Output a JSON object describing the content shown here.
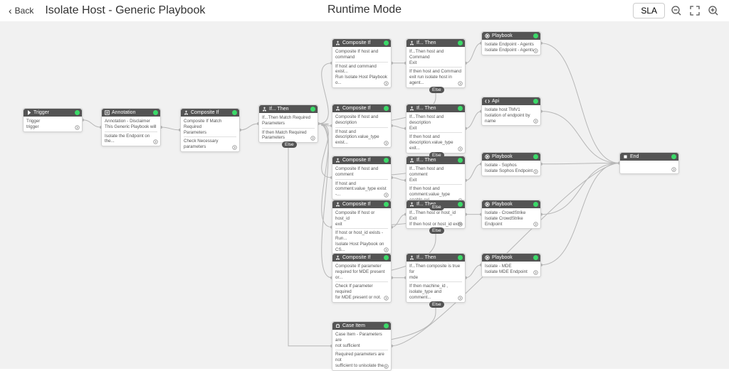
{
  "header": {
    "back_label": "Back",
    "title": "Isolate Host - Generic Playbook",
    "mode_title": "Runtime Mode",
    "sla_label": "SLA"
  },
  "else_label": "Else",
  "nodes": {
    "trigger": {
      "type": "Trigger",
      "line1": "Trigger",
      "line2": "trigger"
    },
    "annot": {
      "type": "Annotation",
      "line1": "Annotation - Disclaimer",
      "line2": "This Generic Playbook will",
      "line3": "Isolate the Endpoint on the..."
    },
    "cif_main": {
      "type": "Composite If",
      "line1": "Composite If Match Required",
      "line2": "Parameters",
      "line3": "Check Necessary parameters"
    },
    "if_main": {
      "type": "If... Then",
      "line1": "If...Then Match Required",
      "line2": "Parameters",
      "line3": "If then Match Required",
      "line4": "Parameters"
    },
    "cif_1": {
      "type": "Composite If",
      "line1": "Composite If host and",
      "line2": "command",
      "line3": "If host and command exist...",
      "line4": "Run Isolate Host Playbook o..."
    },
    "if_1": {
      "type": "If... Then",
      "line1": "If...Then host and Command",
      "line2": "Exit",
      "line3": "If then host and Command",
      "line4": "exit run isolate host in agent..."
    },
    "pb_1": {
      "type": "Playbook",
      "line1": "Isolate Endpoint - Agents",
      "line2": "Isolate Endpoint - Agents"
    },
    "cif_2": {
      "type": "Composite If",
      "line1": "Composite If host and",
      "line2": "description",
      "line3": "If host and",
      "line4": "description.value_type exist..."
    },
    "if_2": {
      "type": "If... Then",
      "line1": "If...Then host and description",
      "line2": "Exit",
      "line3": "If then host and",
      "line4": "description.value_type exit..."
    },
    "api": {
      "type": "Api",
      "line1": "Isolate host TMV1",
      "line2": "Isolation of endpoint by name"
    },
    "cif_3": {
      "type": "Composite If",
      "line1": "Composite If host and",
      "line2": "comment",
      "line3": "If host and",
      "line4": "comment.value_type exist -..."
    },
    "if_3": {
      "type": "If... Then",
      "line1": "If...Then host and comment",
      "line2": "Exit",
      "line3": "If then host and",
      "line4": "comment.value_type enable exi..."
    },
    "pb_3": {
      "type": "Playbook",
      "line1": "Isolate - Sophos",
      "line2": "Isolate Sophos Endpoint"
    },
    "cif_4": {
      "type": "Composite If",
      "line1": "Composite If host or host_id",
      "line2": "exit",
      "line3": "If host or host_id exists - Run...",
      "line4": "Isolate Host Playbook on CS..."
    },
    "if_4": {
      "type": "If... Then",
      "line1": "If...Then host or host_id Exit",
      "line2": "If then host or host_id exist"
    },
    "pb_4": {
      "type": "Playbook",
      "line1": "Isolate - CrowdStrike",
      "line2": "Isolate CrowdStrike Endpoint"
    },
    "cif_5": {
      "type": "Composite If",
      "line1": "Composite If parameter",
      "line2": "required for MDE present or...",
      "line3": "Check If parameter required",
      "line4": "for MDE present or not."
    },
    "if_5": {
      "type": "If... Then",
      "line1": "If...Then composite is true for",
      "line2": "mde",
      "line3": "If then machine_id ,",
      "line4": "isolate_type and comment..."
    },
    "pb_5": {
      "type": "Playbook",
      "line1": "Isolate - MDE",
      "line2": "Isolate MDE Endpoint"
    },
    "caseitem": {
      "type": "Case Item",
      "line1": "Case Item - Parameters are",
      "line2": "not sufficient",
      "line3": "Required parameters are not",
      "line4": "sufficient to unisolate the..."
    },
    "end": {
      "type": "End"
    }
  },
  "chart_data": {
    "type": "flow_diagram",
    "nodes": [
      {
        "id": "trigger",
        "kind": "Trigger"
      },
      {
        "id": "annot",
        "kind": "Annotation"
      },
      {
        "id": "cif_main",
        "kind": "Composite If"
      },
      {
        "id": "if_main",
        "kind": "If... Then"
      },
      {
        "id": "cif_1",
        "kind": "Composite If"
      },
      {
        "id": "if_1",
        "kind": "If... Then"
      },
      {
        "id": "pb_1",
        "kind": "Playbook"
      },
      {
        "id": "cif_2",
        "kind": "Composite If"
      },
      {
        "id": "if_2",
        "kind": "If... Then"
      },
      {
        "id": "api",
        "kind": "Api"
      },
      {
        "id": "cif_3",
        "kind": "Composite If"
      },
      {
        "id": "if_3",
        "kind": "If... Then"
      },
      {
        "id": "pb_3",
        "kind": "Playbook"
      },
      {
        "id": "cif_4",
        "kind": "Composite If"
      },
      {
        "id": "if_4",
        "kind": "If... Then"
      },
      {
        "id": "pb_4",
        "kind": "Playbook"
      },
      {
        "id": "cif_5",
        "kind": "Composite If"
      },
      {
        "id": "if_5",
        "kind": "If... Then"
      },
      {
        "id": "pb_5",
        "kind": "Playbook"
      },
      {
        "id": "caseitem",
        "kind": "Case Item"
      },
      {
        "id": "end",
        "kind": "End"
      }
    ],
    "edges": [
      [
        "trigger",
        "annot"
      ],
      [
        "annot",
        "cif_main"
      ],
      [
        "cif_main",
        "if_main"
      ],
      [
        "if_main",
        "cif_1"
      ],
      [
        "cif_1",
        "if_1"
      ],
      [
        "if_1",
        "pb_1"
      ],
      [
        "if_main",
        "cif_2"
      ],
      [
        "cif_2",
        "if_2"
      ],
      [
        "if_2",
        "api"
      ],
      [
        "if_main",
        "cif_3"
      ],
      [
        "cif_3",
        "if_3"
      ],
      [
        "if_3",
        "pb_3"
      ],
      [
        "if_main",
        "cif_4"
      ],
      [
        "cif_4",
        "if_4"
      ],
      [
        "if_4",
        "pb_4"
      ],
      [
        "if_main",
        "cif_5"
      ],
      [
        "cif_5",
        "if_5"
      ],
      [
        "if_5",
        "pb_5"
      ],
      [
        "if_1",
        "cif_2",
        "else"
      ],
      [
        "if_2",
        "cif_3",
        "else"
      ],
      [
        "if_3",
        "cif_4",
        "else"
      ],
      [
        "if_4",
        "cif_5",
        "else"
      ],
      [
        "if_5",
        "caseitem",
        "else"
      ],
      [
        "if_main",
        "caseitem",
        "else"
      ],
      [
        "pb_1",
        "end"
      ],
      [
        "api",
        "end"
      ],
      [
        "pb_3",
        "end"
      ],
      [
        "pb_4",
        "end"
      ],
      [
        "pb_5",
        "end"
      ],
      [
        "caseitem",
        "end"
      ]
    ]
  }
}
